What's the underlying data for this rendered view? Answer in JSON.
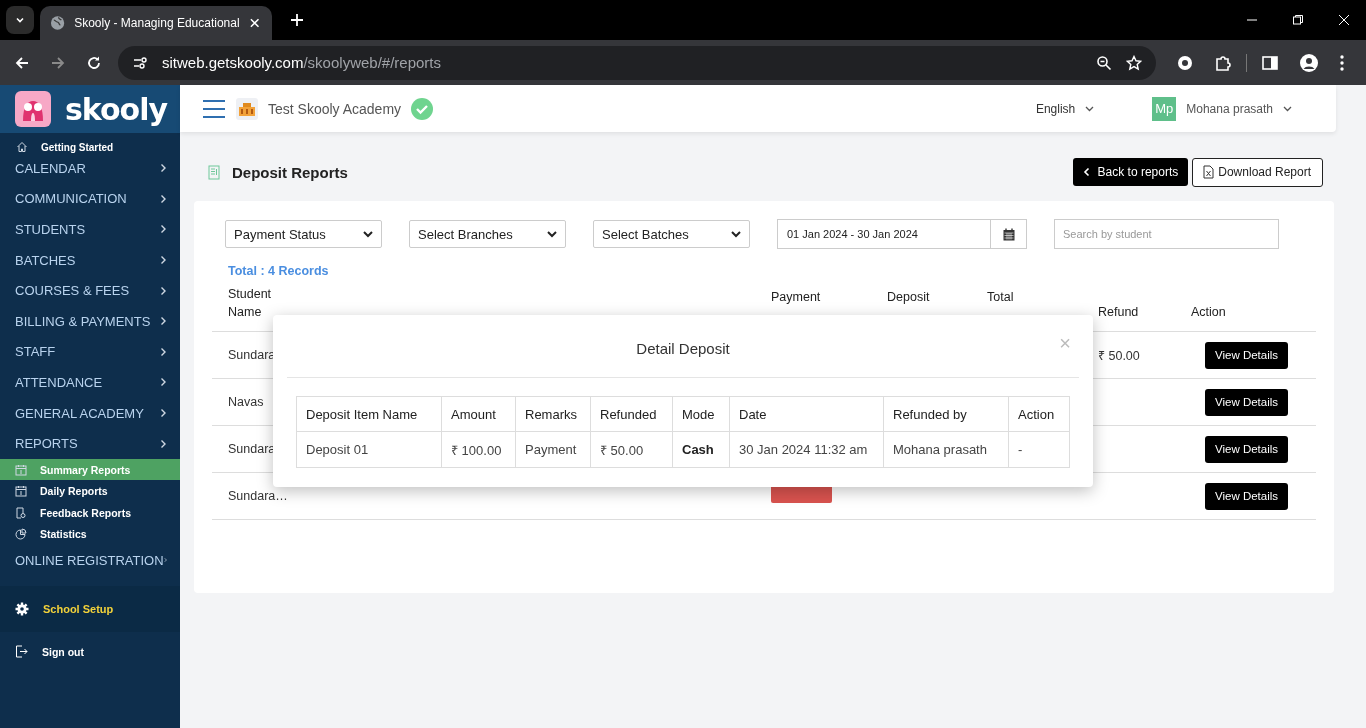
{
  "browser": {
    "tab_title": "Skooly - Managing Educational",
    "url_host": "sitweb.getskooly.com",
    "url_path": "/skoolyweb/#/reports"
  },
  "header": {
    "logo": "skooly",
    "school": "Test Skooly Academy",
    "language": "English",
    "user": {
      "initials": "Mp",
      "name": "Mohana prasath"
    }
  },
  "sidebar": {
    "getting_started": "Getting Started",
    "menu": [
      {
        "label": "CALENDAR"
      },
      {
        "label": "COMMUNICATION"
      },
      {
        "label": "STUDENTS"
      },
      {
        "label": "BATCHES"
      },
      {
        "label": "COURSES & FEES"
      },
      {
        "label": "BILLING & PAYMENTS"
      },
      {
        "label": "STAFF"
      },
      {
        "label": "ATTENDANCE"
      },
      {
        "label": "GENERAL ACADEMY"
      },
      {
        "label": "REPORTS",
        "children": [
          {
            "label": "Summary Reports",
            "selected": true
          },
          {
            "label": "Daily Reports",
            "selected": false
          },
          {
            "label": "Feedback Reports",
            "selected": false
          },
          {
            "label": "Statistics",
            "selected": false
          }
        ]
      },
      {
        "label": "ONLINE REGISTRATION"
      }
    ],
    "school_setup": "School Setup",
    "sign_out": "Sign out"
  },
  "page": {
    "title": "Deposit Reports",
    "back_button": "Back to reports",
    "download_button": "Download Report",
    "filters": [
      "Payment Status",
      "Select Branches",
      "Select Batches"
    ],
    "date_range": "01 Jan 2024 - 30 Jan 2024",
    "search": {
      "placeholder": "Search by student"
    },
    "total": "Total : 4 Records"
  },
  "table": {
    "columns": [
      "Student Name",
      "Payment",
      "Deposit",
      "Total",
      "Refund",
      "Action"
    ],
    "rows": [
      {
        "student": "Sundara",
        "refund": "₹ 50.00",
        "action": "View Details"
      },
      {
        "student": "Navas",
        "action": "View Details"
      },
      {
        "student": "Sundara",
        "action": "View Details"
      },
      {
        "student": "Sundara…",
        "status_badge": true,
        "action": "View Details"
      }
    ]
  },
  "modal": {
    "title": "Detail Deposit",
    "close": "×",
    "columns": [
      "Deposit Item Name",
      "Amount",
      "Remarks",
      "Refunded",
      "Mode",
      "Date",
      "Refunded by",
      "Action"
    ],
    "rows": [
      [
        "Deposit 01",
        "₹ 100.00",
        "Payment",
        "₹ 50.00",
        "Cash",
        "30 Jan 2024 11:32 am",
        "Mohana prasath",
        "-"
      ]
    ]
  }
}
